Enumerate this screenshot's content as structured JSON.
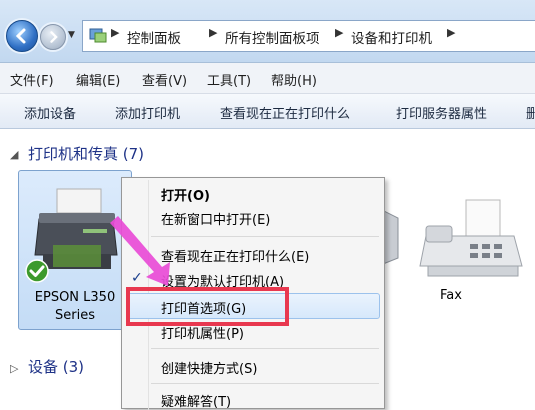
{
  "address_bar": {
    "breadcrumbs": [
      "控制面板",
      "所有控制面板项",
      "设备和打印机"
    ]
  },
  "menu_bar": {
    "items": [
      "文件(F)",
      "编辑(E)",
      "查看(V)",
      "工具(T)",
      "帮助(H)"
    ]
  },
  "toolbar": {
    "items": [
      "添加设备",
      "添加打印机",
      "查看现在正在打印什么",
      "打印服务器属性",
      "删"
    ]
  },
  "groups": {
    "printers": {
      "label": "打印机和传真 (7)"
    },
    "devices": {
      "label": "设备 (3)"
    }
  },
  "printer_tile": {
    "label_line1": "EPSON L350",
    "label_line2": "Series",
    "default": true
  },
  "fax": {
    "label": "Fax"
  },
  "context_menu": {
    "items": [
      {
        "label": "打开(O)",
        "bold": true
      },
      {
        "label": "在新窗口中打开(E)"
      },
      {
        "label": "查看现在正在打印什么(E)"
      },
      {
        "label": "设置为默认打印机(A)",
        "checked": true
      },
      {
        "label": "打印首选项(G)",
        "highlighted": true
      },
      {
        "label": "打印机属性(P)"
      },
      {
        "label": "创建快捷方式(S)"
      },
      {
        "label": "疑难解答(T)"
      }
    ]
  },
  "annotation": {
    "arrow_color": "#e84bd6",
    "box_color": "#e8384f"
  }
}
